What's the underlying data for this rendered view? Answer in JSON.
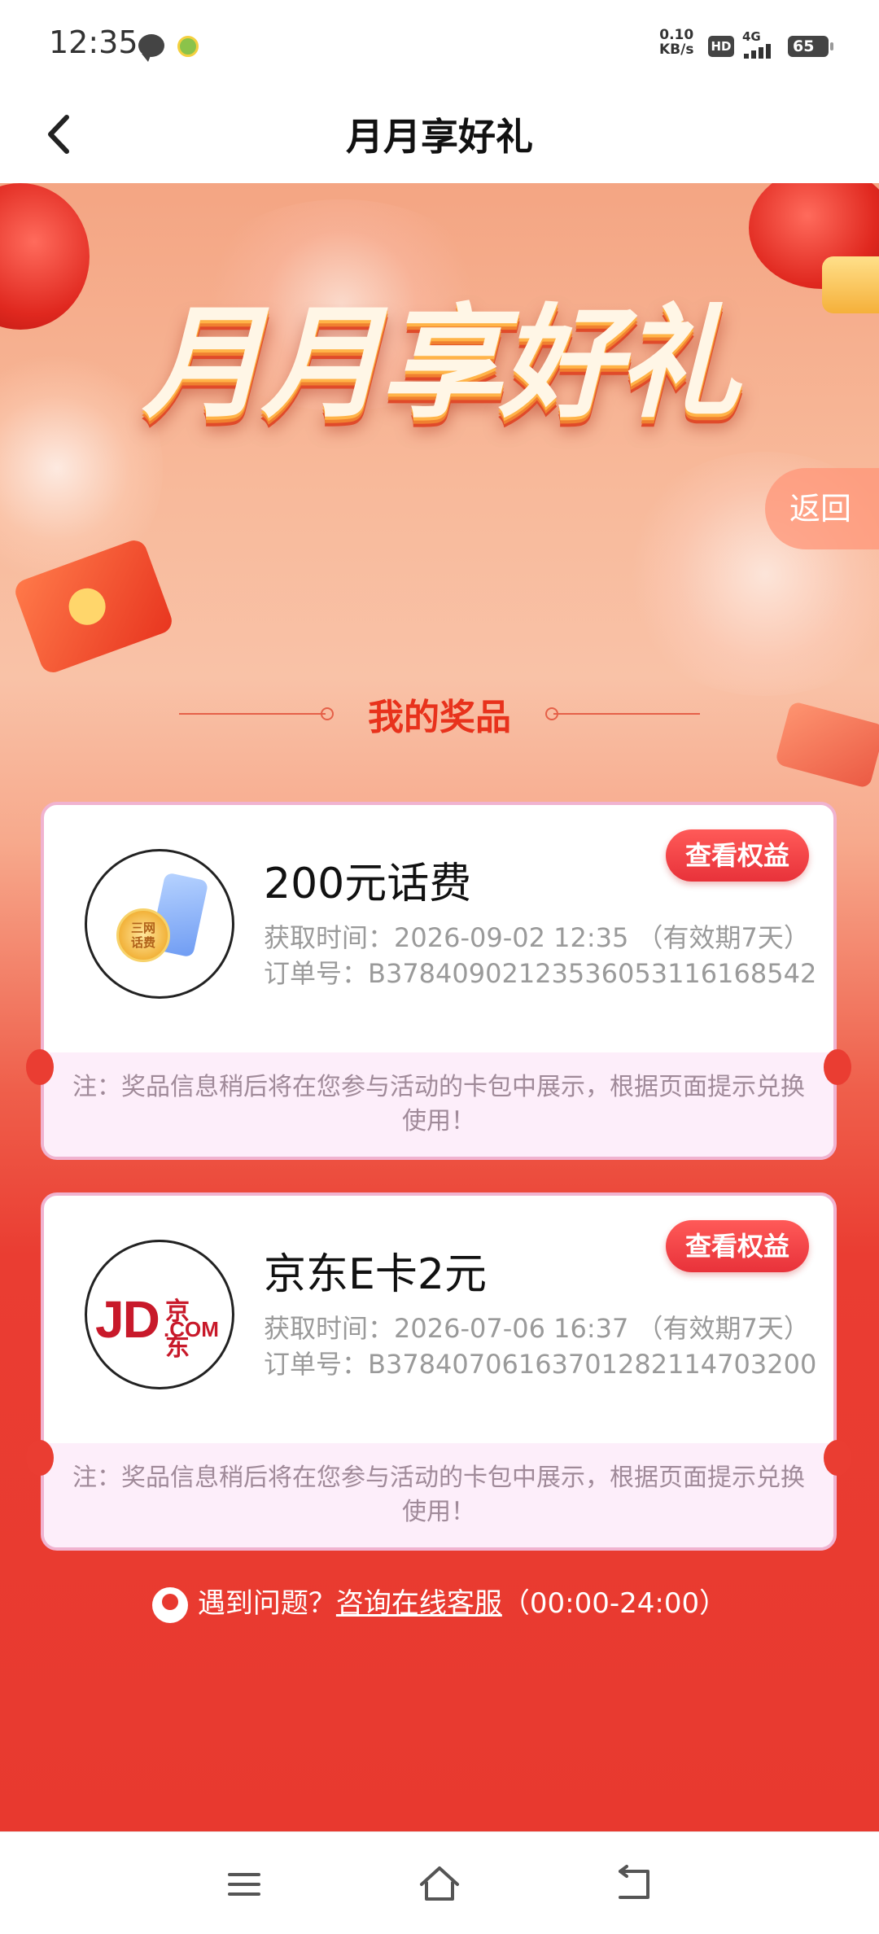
{
  "status_bar": {
    "time": "12:35",
    "net_speed_value": "0.10",
    "net_speed_unit": "KB/s",
    "hd": "HD",
    "signal": "4G",
    "battery": "65"
  },
  "header": {
    "title": "月月享好礼"
  },
  "hero": {
    "title": "月月享好礼",
    "return_label": "返回"
  },
  "section": {
    "title": "我的奖品"
  },
  "prizes": [
    {
      "name": "200元话费",
      "time": "获取时间：2026-09-02 12:35 （有效期7天）",
      "order": "订单号：B3784090212353605311616854​2",
      "button": "查看权益",
      "note": "注：奖品信息稍后将在您参与活动的卡包中展示，根据页面提示兑换使用！",
      "coin_text": "三网\n话费"
    },
    {
      "name": "京东E卡2元",
      "time": "获取时间：2026-07-06 16:37 （有效期7天）",
      "order": "订单号：B3784070616370128211470320​0",
      "button": "查看权益",
      "note": "注：奖品信息稍后将在您参与活动的卡包中展示，根据页面提示兑换使用！",
      "logo_big": "JD",
      "logo_cn": "京东",
      "logo_com": ".COM"
    }
  ],
  "help": {
    "prefix": "遇到问题？",
    "link": "咨询在线客服",
    "hours": "（00:00-24:00）"
  },
  "colors": {
    "accent": "#e8392f",
    "button": "#e8323a",
    "note_bg": "#fdeefa"
  }
}
